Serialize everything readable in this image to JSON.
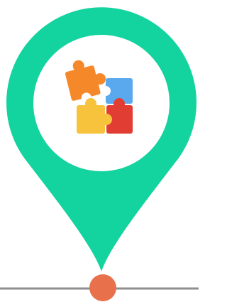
{
  "colors": {
    "pin": "#13D39F",
    "pin_inner": "#FFFFFF",
    "timeline": "#8E8E8E",
    "timeline_dot": "#E8704A",
    "puzzle_orange": "#F5892A",
    "puzzle_blue": "#5AA9EE",
    "puzzle_yellow": "#F7C33C",
    "puzzle_red": "#E23D33"
  },
  "icons": {
    "marker": "map-pin-icon",
    "content": "puzzle-pieces-icon"
  }
}
